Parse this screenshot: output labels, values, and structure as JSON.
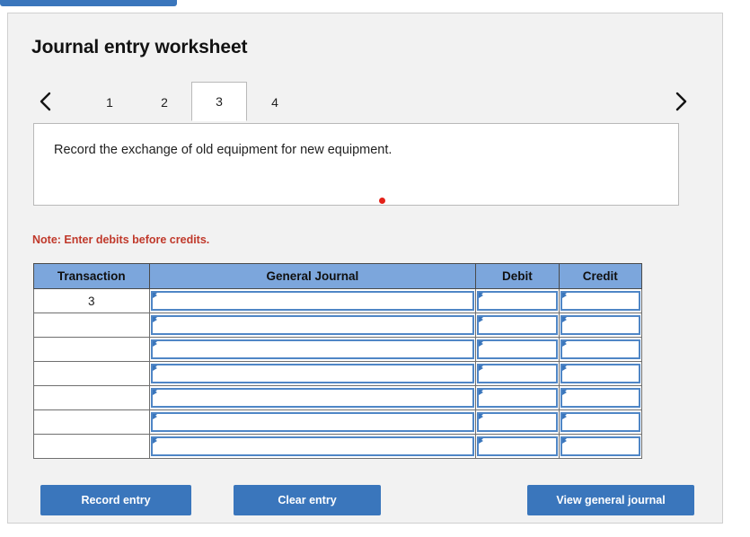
{
  "top_bar": {
    "name": "partial-blue-bar"
  },
  "card": {
    "title": "Journal entry worksheet"
  },
  "tabs": {
    "prev_icon": "chevron-left-icon",
    "next_icon": "chevron-right-icon",
    "items": [
      {
        "label": "1",
        "active": false
      },
      {
        "label": "2",
        "active": false
      },
      {
        "label": "3",
        "active": true
      },
      {
        "label": "4",
        "active": false
      }
    ]
  },
  "instruction": {
    "text": "Record the exchange of old equipment for new equipment.",
    "marker": "red-dot"
  },
  "note": "Note: Enter debits before credits.",
  "table": {
    "headers": [
      "Transaction",
      "General Journal",
      "Debit",
      "Credit"
    ],
    "rows": [
      {
        "transaction": "3",
        "general_journal": "",
        "debit": "",
        "credit": ""
      },
      {
        "transaction": "",
        "general_journal": "",
        "debit": "",
        "credit": ""
      },
      {
        "transaction": "",
        "general_journal": "",
        "debit": "",
        "credit": ""
      },
      {
        "transaction": "",
        "general_journal": "",
        "debit": "",
        "credit": ""
      },
      {
        "transaction": "",
        "general_journal": "",
        "debit": "",
        "credit": ""
      },
      {
        "transaction": "",
        "general_journal": "",
        "debit": "",
        "credit": ""
      },
      {
        "transaction": "",
        "general_journal": "",
        "debit": "",
        "credit": ""
      }
    ]
  },
  "buttons": {
    "record": "Record entry",
    "clear": "Clear entry",
    "view": "View general journal"
  },
  "colors": {
    "accent_blue": "#3a76bc",
    "header_blue": "#7ca6dc",
    "note_red": "#c0392b",
    "dot_red": "#e32119",
    "card_bg": "#f2f2f2"
  }
}
